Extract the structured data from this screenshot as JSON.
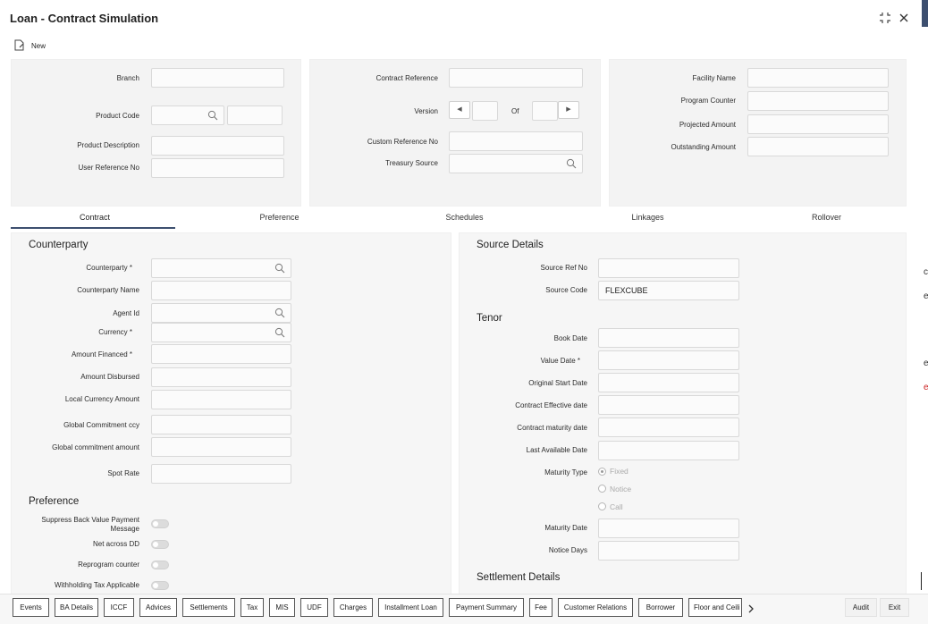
{
  "window": {
    "title": "Loan - Contract Simulation"
  },
  "toolbar": {
    "new_label": "New"
  },
  "header": {
    "branch_label": "Branch",
    "product_code_label": "Product Code",
    "product_description_label": "Product Description",
    "user_reference_label": "User Reference No",
    "contract_reference_label": "Contract Reference",
    "version_label": "Version",
    "of_label": "Of",
    "custom_reference_label": "Custom Reference No",
    "treasury_source_label": "Treasury Source",
    "facility_name_label": "Facility Name",
    "program_counter_label": "Program Counter",
    "projected_amount_label": "Projected Amount",
    "outstanding_amount_label": "Outstanding Amount"
  },
  "tabs": [
    "Contract",
    "Preference",
    "Schedules",
    "Linkages",
    "Rollover"
  ],
  "counterparty": {
    "title": "Counterparty",
    "counterparty_label": "Counterparty",
    "counterparty_name_label": "Counterparty Name",
    "agent_id_label": "Agent Id",
    "currency_label": "Currency",
    "amount_financed_label": "Amount Financed",
    "amount_disbursed_label": "Amount Disbursed",
    "local_currency_amount_label": "Local Currency Amount",
    "global_commitment_ccy_label": "Global Commitment ccy",
    "global_commitment_amount_label": "Global commitment amount",
    "spot_rate_label": "Spot Rate"
  },
  "preference": {
    "title": "Preference",
    "suppress_label": "Suppress Back Value Payment Message",
    "net_across_dd_label": "Net across DD",
    "reprogram_counter_label": "Reprogram counter",
    "withholding_tax_label": "Withholding Tax Applicable"
  },
  "source_details": {
    "title": "Source Details",
    "source_ref_label": "Source Ref No",
    "source_code_label": "Source Code",
    "source_code_value": "FLEXCUBE"
  },
  "tenor": {
    "title": "Tenor",
    "book_date_label": "Book Date",
    "value_date_label": "Value Date",
    "original_start_date_label": "Original Start Date",
    "contract_effective_date_label": "Contract Effective date",
    "contract_maturity_date_label": "Contract maturity date",
    "last_available_date_label": "Last Available Date",
    "maturity_type_label": "Maturity Type",
    "maturity_options": [
      "Fixed",
      "Notice",
      "Call"
    ],
    "maturity_selected": "Fixed",
    "maturity_date_label": "Maturity Date",
    "notice_days_label": "Notice Days"
  },
  "settlement": {
    "title": "Settlement Details"
  },
  "footer": {
    "buttons": [
      "Events",
      "BA Details",
      "ICCF",
      "Advices",
      "Settlements",
      "Tax",
      "MIS",
      "UDF",
      "Charges",
      "Installment Loan",
      "Payment Summary",
      "Fee",
      "Customer Relations",
      "Borrower",
      "Floor and Ceili"
    ],
    "audit_label": "Audit",
    "exit_label": "Exit"
  },
  "edge_fragments": [
    "c",
    "e",
    "e",
    "e"
  ]
}
